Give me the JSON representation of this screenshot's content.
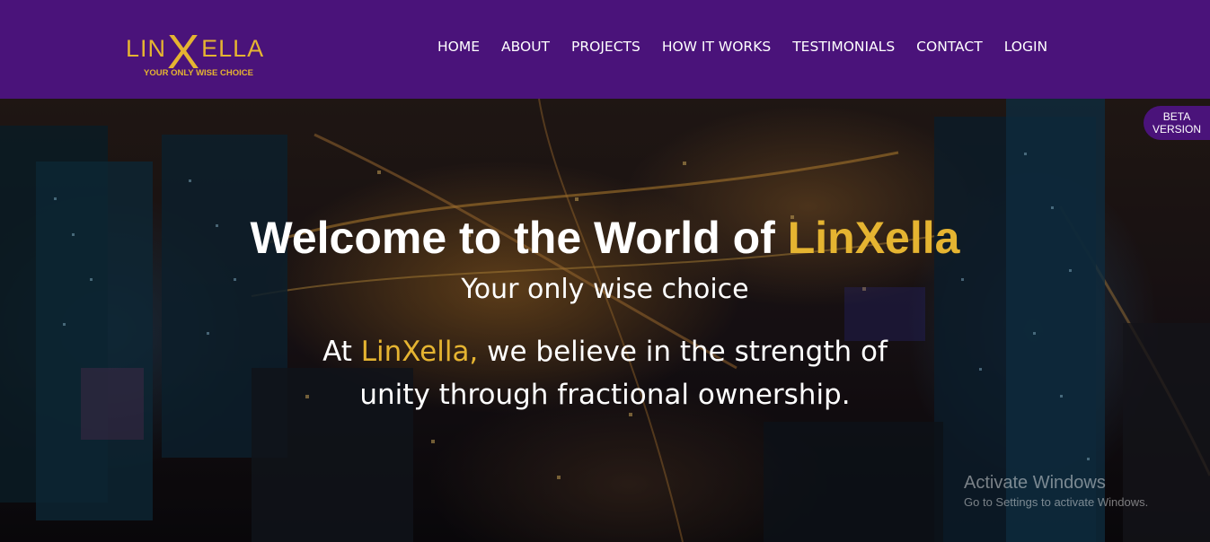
{
  "brand": {
    "logo_left": "LIN",
    "logo_x": "X",
    "logo_right": "ELLA",
    "tagline": "YOUR ONLY WISE CHOICE",
    "accent_color": "#e5b431",
    "header_color": "#4a137a"
  },
  "nav": {
    "items": [
      "HOME",
      "ABOUT",
      "PROJECTS",
      "HOW IT WORKS",
      "TESTIMONIALS",
      "CONTACT",
      "LOGIN"
    ]
  },
  "badge": {
    "line1": "BETA",
    "line2": "VERSION"
  },
  "hero": {
    "title_prefix": "Welcome to the World of ",
    "title_accent": "LinXella",
    "subtitle": "Your only wise choice",
    "body_prefix": "At ",
    "body_accent": "LinXella,",
    "body_rest_line1": " we believe in the strength of",
    "body_line2": "unity through fractional ownership."
  },
  "watermark": {
    "title": "Activate Windows",
    "subtitle": "Go to Settings to activate Windows."
  }
}
